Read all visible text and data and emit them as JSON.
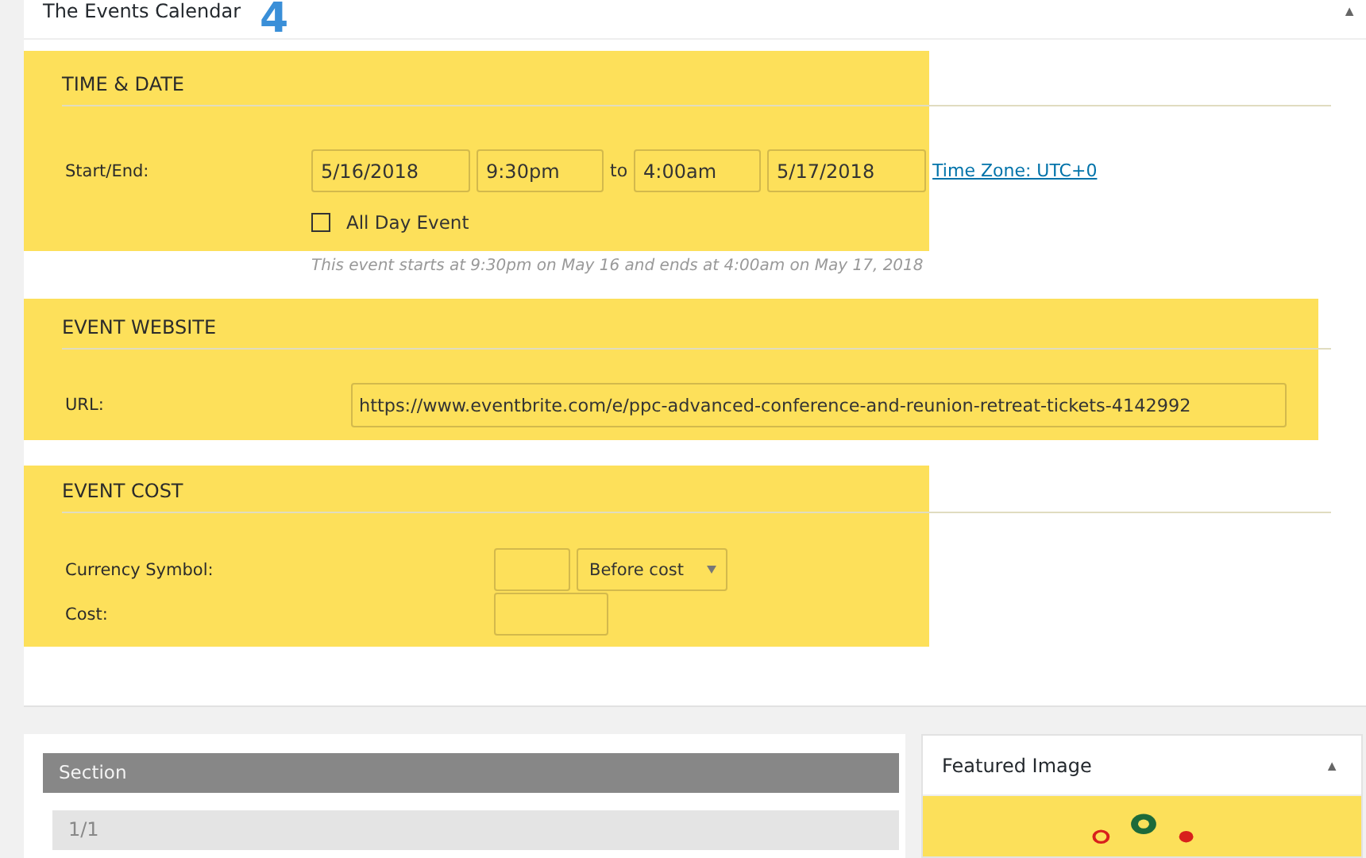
{
  "panel": {
    "title": "The Events Calendar",
    "step_number": "4",
    "collapse_icon": "▲"
  },
  "sections": [
    {
      "kind": "datetime",
      "title": "TIME & DATE",
      "highlighted": true,
      "label": "Start/End:",
      "start_date": "5/16/2018",
      "start_time": "9:30pm",
      "separator": "to",
      "end_time": "4:00am",
      "end_date": "5/17/2018",
      "timezone_link": "Time Zone: UTC+0",
      "all_day": {
        "label": "All Day Event",
        "checked": false
      },
      "hint": "This event starts at 9:30pm on May 16 and ends at 4:00am on May 17, 2018"
    },
    {
      "kind": "website",
      "title": "EVENT WEBSITE",
      "highlighted": true,
      "label": "URL:",
      "value": "https://www.eventbrite.com/e/ppc-advanced-conference-and-reunion-retreat-tickets-4142992"
    },
    {
      "kind": "cost",
      "title": "EVENT COST",
      "highlighted": true,
      "currency_label": "Currency Symbol:",
      "position_select": "Before cost",
      "cost_label": "Cost:"
    }
  ],
  "section_table": {
    "header": "Section",
    "rows": [
      "1/1"
    ]
  },
  "featured_image": {
    "title": "Featured Image",
    "collapse_icon": "▲"
  }
}
